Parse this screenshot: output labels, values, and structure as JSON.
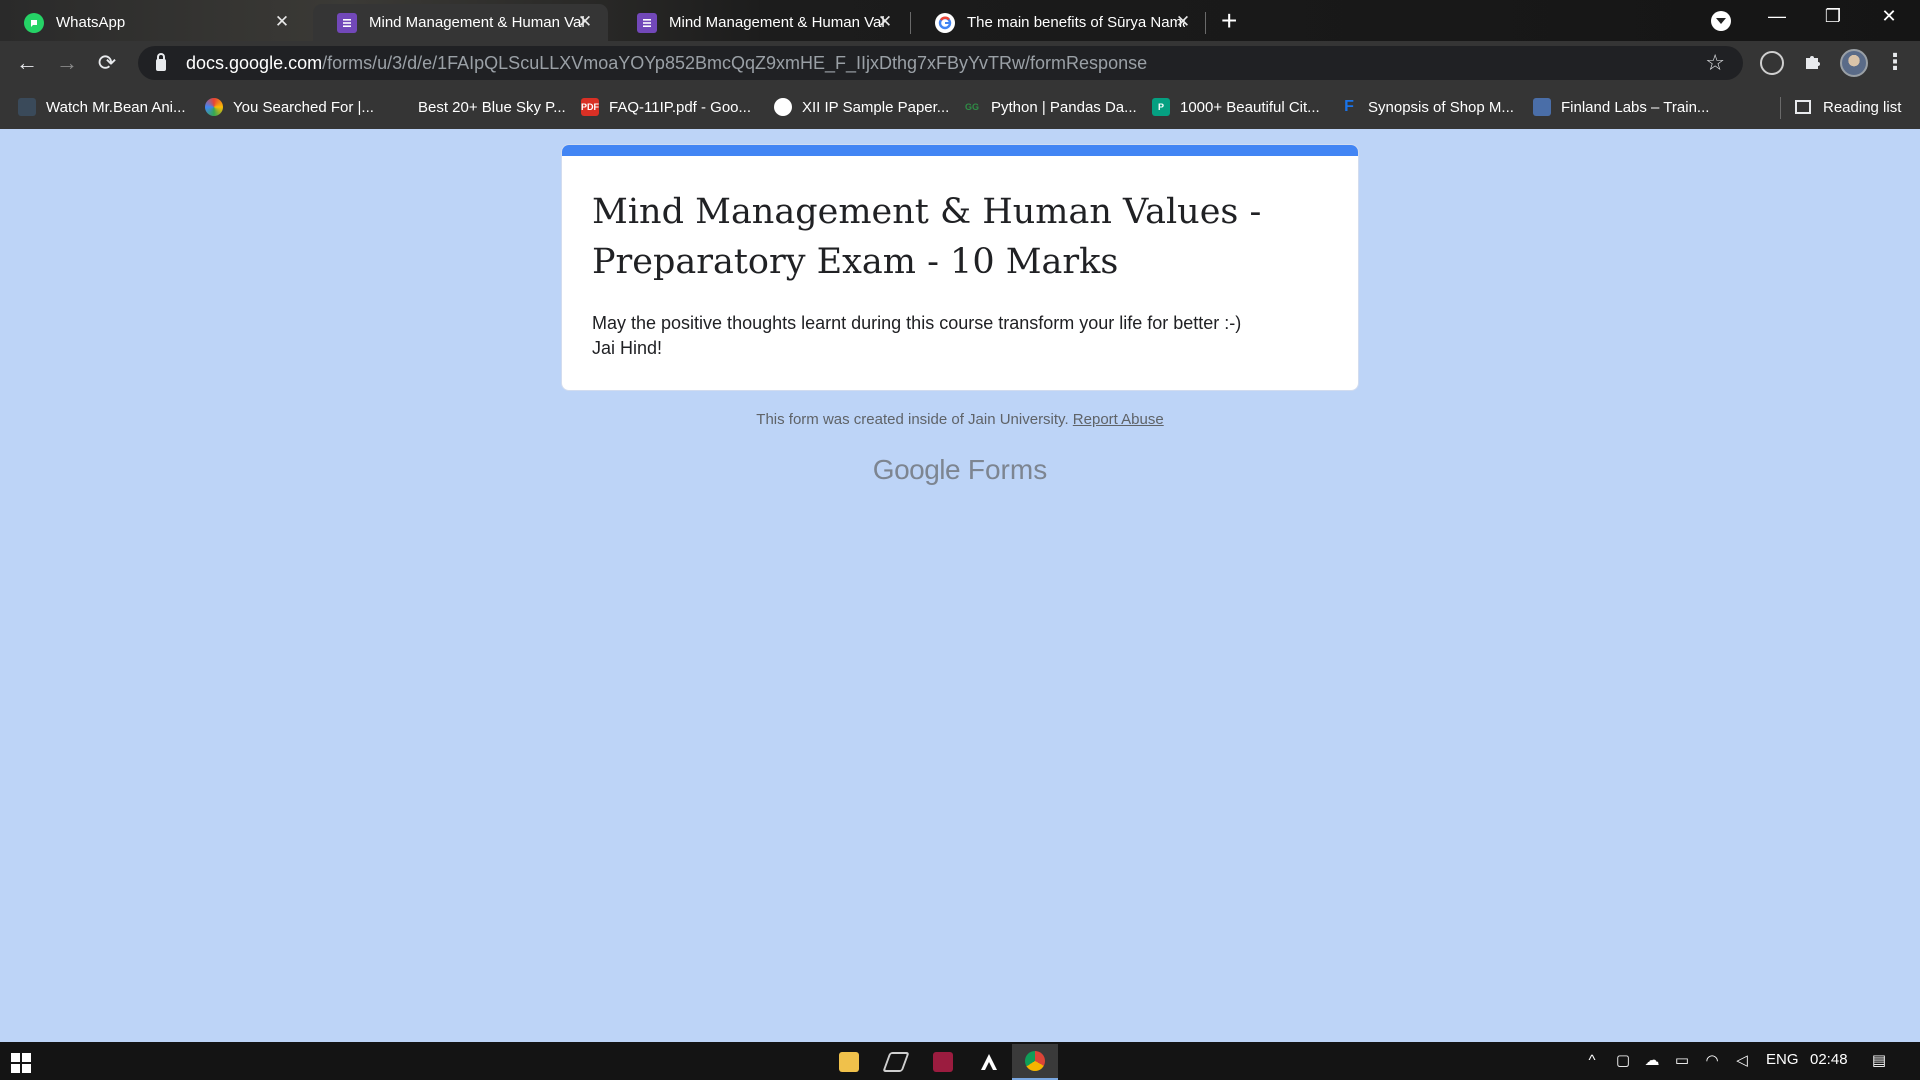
{
  "tabs": [
    {
      "title": "WhatsApp",
      "icon": "whatsapp-icon",
      "active": false
    },
    {
      "title": "Mind Management & Human Val",
      "icon": "google-forms-icon",
      "active": true
    },
    {
      "title": "Mind Management & Human Val",
      "icon": "google-forms-icon",
      "active": false
    },
    {
      "title": "The main benefits of Sūrya Nama",
      "icon": "google-icon",
      "active": false
    }
  ],
  "tab_close_glyph": "✕",
  "new_tab_glyph": "+",
  "window_controls": {
    "minimize": "—",
    "restore": "❐",
    "close": "✕"
  },
  "toolbar": {
    "back": "←",
    "forward": "→",
    "reload": "⟳",
    "url_host": "docs.google.com",
    "url_path": "/forms/u/3/d/e/1FAIpQLScuLLXVmoaYOYp852BmcQqZ9xmHE_F_IIjxDthg7xFByYvTRw/formResponse",
    "star": "☆",
    "menu": "⋮"
  },
  "bookmarks": [
    {
      "label": "Watch Mr.Bean Ani...",
      "icon": "tumblr-icon"
    },
    {
      "label": "You Searched For |...",
      "icon": "rainbow-logo-icon"
    },
    {
      "label": "Best 20+ Blue Sky P...",
      "icon": "blank-page-icon"
    },
    {
      "label": "FAQ-11IP.pdf - Goo...",
      "icon": "pdf-icon"
    },
    {
      "label": "XII IP Sample Paper...",
      "icon": "globe-icon"
    },
    {
      "label": "Python | Pandas Da...",
      "icon": "geeksforgeeks-icon"
    },
    {
      "label": "1000+ Beautiful Cit...",
      "icon": "pexels-icon"
    },
    {
      "label": "Synopsis of Shop M...",
      "icon": "f-logo-icon"
    },
    {
      "label": "Finland Labs – Train...",
      "icon": "finland-labs-icon"
    }
  ],
  "reading_list": "Reading list",
  "form": {
    "title": "Mind Management & Human Values - Preparatory Exam - 10 Marks",
    "description_line1": "May the positive thoughts learnt during this course transform your life for better :-)",
    "description_line2": "Jai Hind!",
    "footer_text": "This form was created inside of Jain University.",
    "report_link": "Report Abuse",
    "brand_google": "Google",
    "brand_forms": "Forms"
  },
  "taskbar": {
    "language": "ENG",
    "time": "02:48",
    "apps": [
      "file-explorer-icon",
      "stylized-app-icon",
      "vscode-like-icon",
      "assassins-creed-icon",
      "chrome-icon"
    ]
  },
  "colors": {
    "page_background": "#bdd4f7",
    "form_accent": "#4285f4",
    "forms_purple": "#7248b9"
  }
}
